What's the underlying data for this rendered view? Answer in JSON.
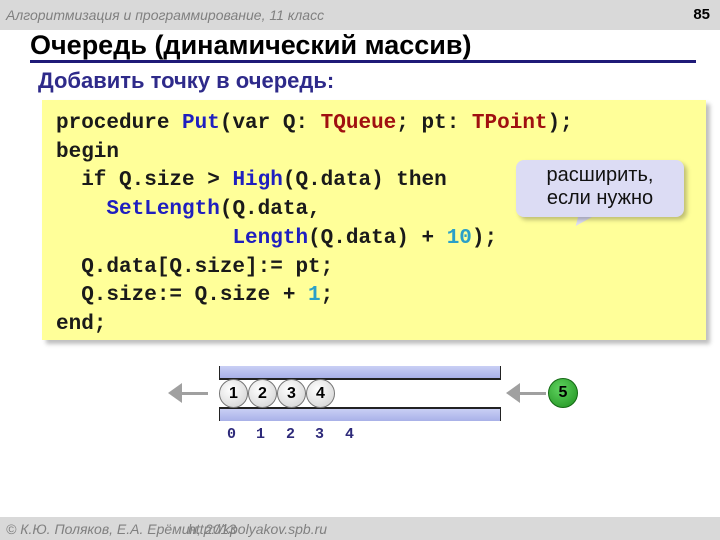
{
  "header": {
    "course": "Алгоритмизация и программирование, 11 класс",
    "page_number": "85"
  },
  "slide": {
    "title": "Очередь (динамический массив)",
    "subtitle": "Добавить точку в очередь:"
  },
  "code": {
    "line1": {
      "kw1": "procedure ",
      "fn": "Put",
      "p1": "(var Q: ",
      "ty1": "TQueue",
      "p2": "; pt: ",
      "ty2": "TPoint",
      "p3": ");"
    },
    "line2": {
      "kw": "begin"
    },
    "line3": {
      "p1": "  if Q.size > ",
      "fn": "High",
      "p2": "(Q.data) then"
    },
    "line4": {
      "p1": "    ",
      "fn": "SetLength",
      "p2": "(Q.data,"
    },
    "line5": {
      "p1": "              ",
      "fn": "Length",
      "p2": "(Q.data) + ",
      "num": "10",
      "p3": ");"
    },
    "line6": {
      "p1": "  Q.data[Q.size]:= pt;"
    },
    "line7": {
      "p1": "  Q.size:= Q.size + ",
      "num": "1",
      "p2": ";"
    },
    "line8": {
      "kw": "end;"
    }
  },
  "callout": {
    "line1": "расширить,",
    "line2": "если нужно"
  },
  "queue": {
    "elements": [
      "1",
      "2",
      "3",
      "4"
    ],
    "new_element": "5",
    "indices": [
      "0",
      "1",
      "2",
      "3",
      "4"
    ]
  },
  "footer": {
    "copyright": "© К.Ю. Поляков, Е.А. Ерёмин, 2013",
    "url": "http://kpolyakov.spb.ru"
  },
  "colors": {
    "code_background": "#ffff99",
    "keyword_function": "#1f1fbf",
    "type": "#a01010",
    "number": "#2aa0c8",
    "title_rule": "#1f1a78",
    "new_ball": "#2aa52a"
  }
}
